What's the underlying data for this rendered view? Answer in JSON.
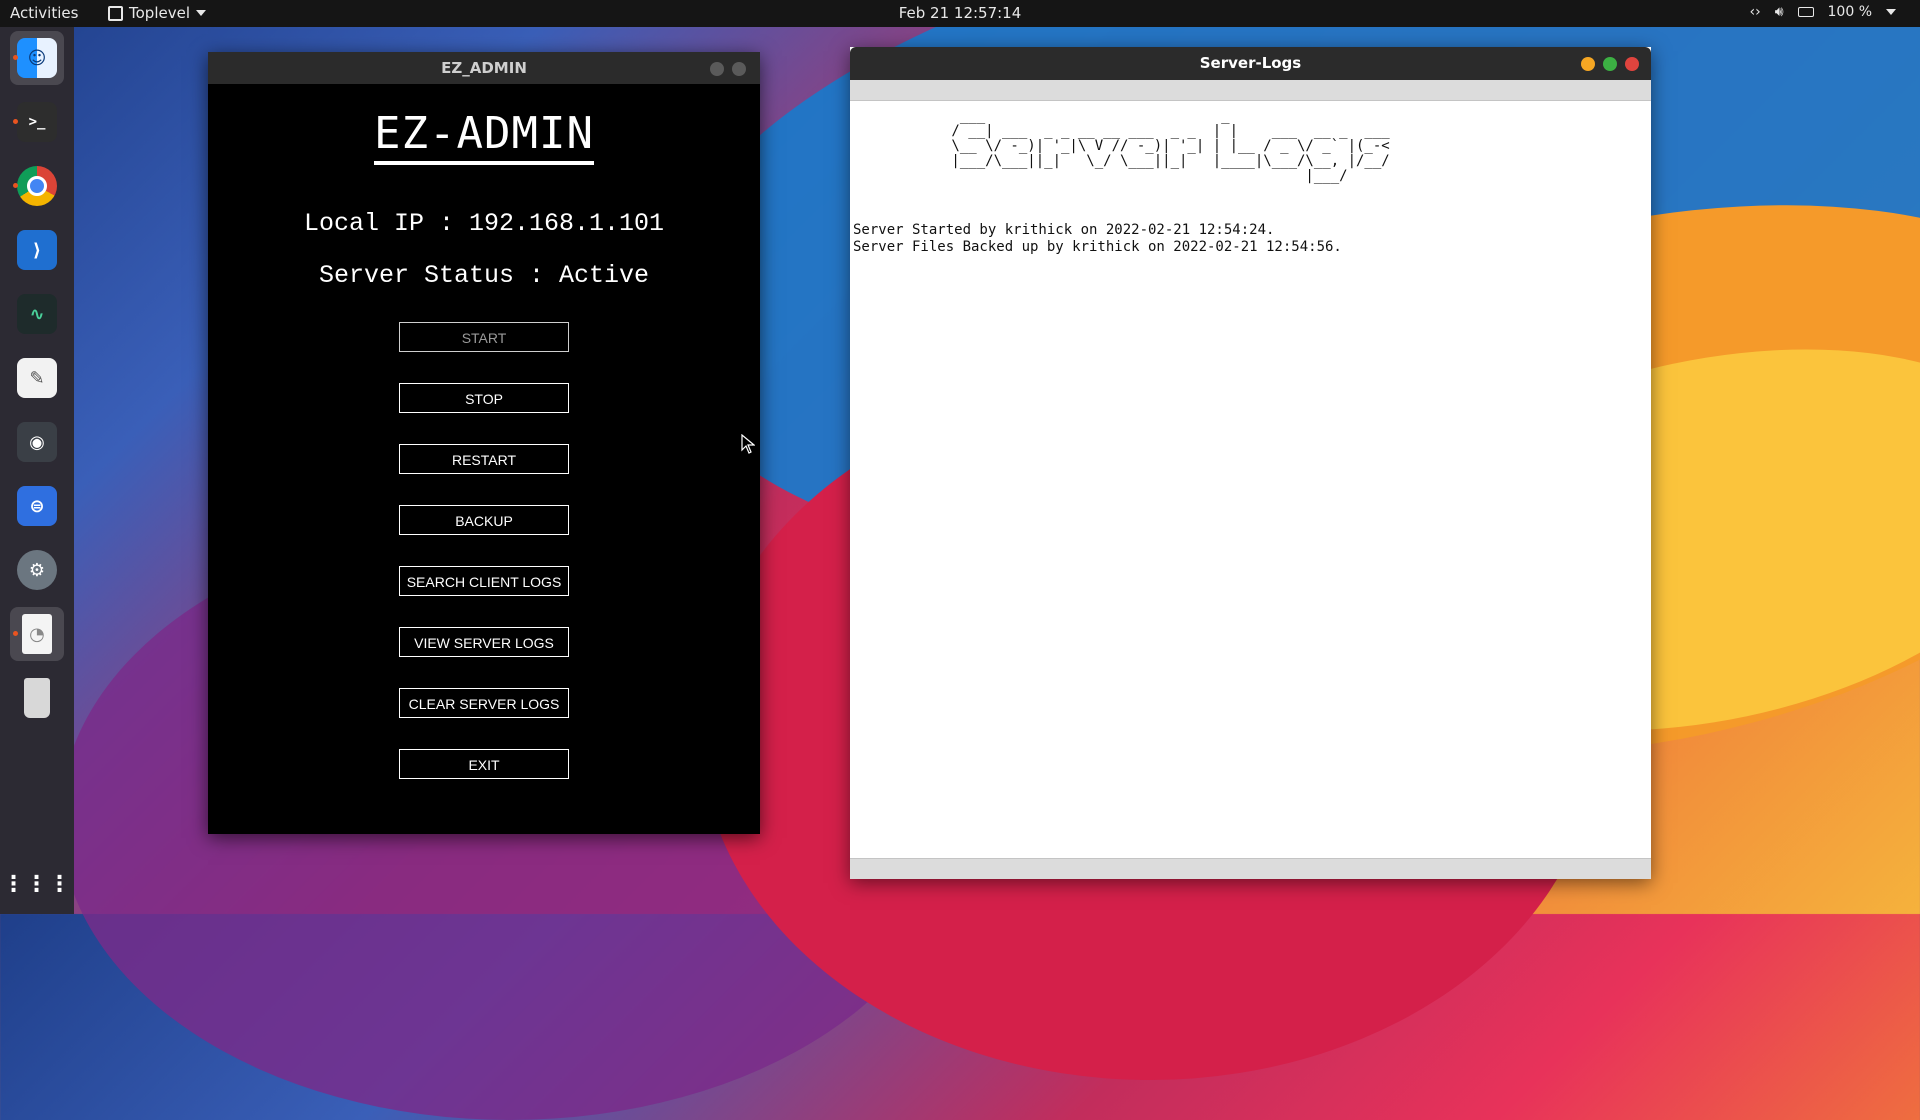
{
  "topbar": {
    "activities": "Activities",
    "app_name": "Toplevel",
    "clock": "Feb 21  12:57:14",
    "battery": "100 %"
  },
  "dock": {
    "items": [
      {
        "name": "finder",
        "running": true,
        "color": "#1e90ff"
      },
      {
        "name": "terminal",
        "running": true,
        "color": "#2d2d2d"
      },
      {
        "name": "chrome",
        "running": true,
        "color": "#ffffff"
      },
      {
        "name": "vscode",
        "running": false,
        "color": "#1f6fd0"
      },
      {
        "name": "system-monitor",
        "running": false,
        "color": "#2b3a3a"
      },
      {
        "name": "text-editor",
        "running": false,
        "color": "#f2f2f2"
      },
      {
        "name": "screenshot",
        "running": false,
        "color": "#3a3f46"
      },
      {
        "name": "tweaks",
        "running": false,
        "color": "#2f6fe0"
      },
      {
        "name": "settings",
        "running": false,
        "color": "#6b7680"
      },
      {
        "name": "document-viewer",
        "running": true,
        "color": "#f4f4f4"
      },
      {
        "name": "trash",
        "running": false,
        "color": "#d8d8d8"
      }
    ],
    "apps_grid": "apps-grid"
  },
  "ez_admin": {
    "window_title": "EZ_ADMIN",
    "heading": "EZ-ADMIN",
    "local_ip": "Local IP : 192.168.1.101",
    "server_status": "Server Status : Active",
    "buttons": [
      {
        "label": "START",
        "enabled": false
      },
      {
        "label": "STOP",
        "enabled": true
      },
      {
        "label": "RESTART",
        "enabled": true
      },
      {
        "label": "BACKUP",
        "enabled": true
      },
      {
        "label": "SEARCH CLIENT LOGS",
        "enabled": true
      },
      {
        "label": "VIEW SERVER LOGS",
        "enabled": true
      },
      {
        "label": "CLEAR SERVER LOGS",
        "enabled": true
      },
      {
        "label": "EXIT",
        "enabled": true
      }
    ]
  },
  "server_logs": {
    "window_title": "Server-Logs",
    "ascii_banner": "  ___                            _                     \n / __| ___  _ _ __ __ ___  _ _  | |    ___  __ _  ___ \n \\__ \\/ -_)| '_|\\ V // -_)| '_| | |__ / _ \\/ _` |(_-< \n |___/\\___||_|   \\_/ \\___||_|   |____|\\___/\\__, |/__/ \n                                           |___/      ",
    "lines": [
      "Server Started by krithick on 2022-02-21 12:54:24.",
      "Server Files Backed up by krithick on 2022-02-21 12:54:56."
    ]
  }
}
